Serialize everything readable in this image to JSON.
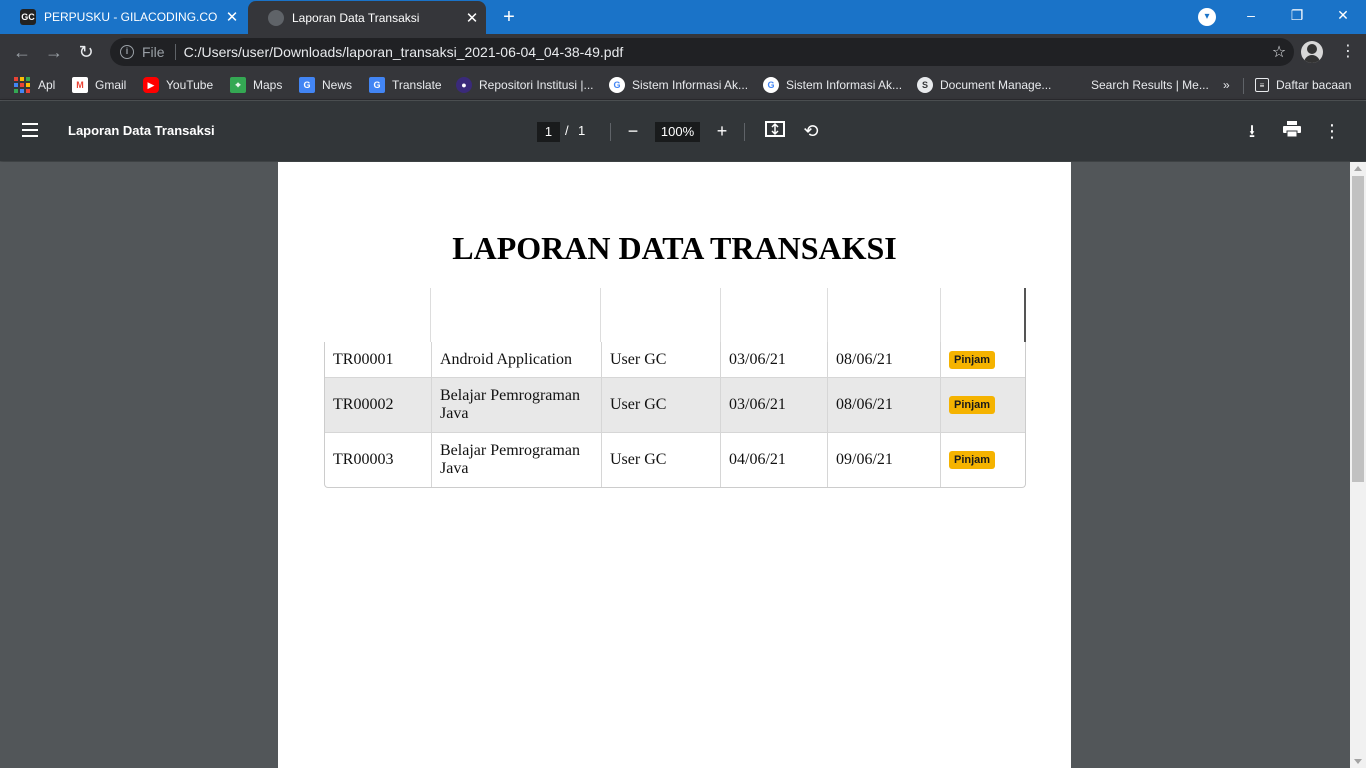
{
  "tabs": [
    {
      "title": "PERPUSKU - GILACODING.COM",
      "favicon": "GC"
    },
    {
      "title": "Laporan Data Transaksi"
    }
  ],
  "omnibox": {
    "scheme": "File",
    "url": "C:/Users/user/Downloads/laporan_transaksi_2021-06-04_04-38-49.pdf"
  },
  "bookmarks": [
    {
      "label": "Apl"
    },
    {
      "label": "Gmail"
    },
    {
      "label": "YouTube"
    },
    {
      "label": "Maps"
    },
    {
      "label": "News"
    },
    {
      "label": "Translate"
    },
    {
      "label": "Repositori Institusi |..."
    },
    {
      "label": "Sistem Informasi Ak..."
    },
    {
      "label": "Sistem Informasi Ak..."
    },
    {
      "label": "Document Manage..."
    },
    {
      "label": "Search Results | Me..."
    },
    {
      "label": "Daftar bacaan"
    }
  ],
  "pdf_toolbar": {
    "title": "Laporan Data Transaksi",
    "page": "1",
    "page_sep": "/",
    "total": "1",
    "zoom": "100%"
  },
  "document": {
    "title": "LAPORAN DATA TRANSAKSI",
    "rows": [
      [
        "TR00001",
        "Android Application",
        "User GC",
        "03/06/21",
        "08/06/21",
        "Pinjam"
      ],
      [
        "TR00002",
        "Belajar Pemrograman Java",
        "User GC",
        "03/06/21",
        "08/06/21",
        "Pinjam"
      ],
      [
        "TR00003",
        "Belajar Pemrograman Java",
        "User GC",
        "04/06/21",
        "09/06/21",
        "Pinjam"
      ]
    ]
  },
  "colors": {
    "tabstrip": "#1a73c8",
    "toolbar": "#35363a",
    "pdf_bar": "#323639",
    "badge": "#f5b300"
  }
}
